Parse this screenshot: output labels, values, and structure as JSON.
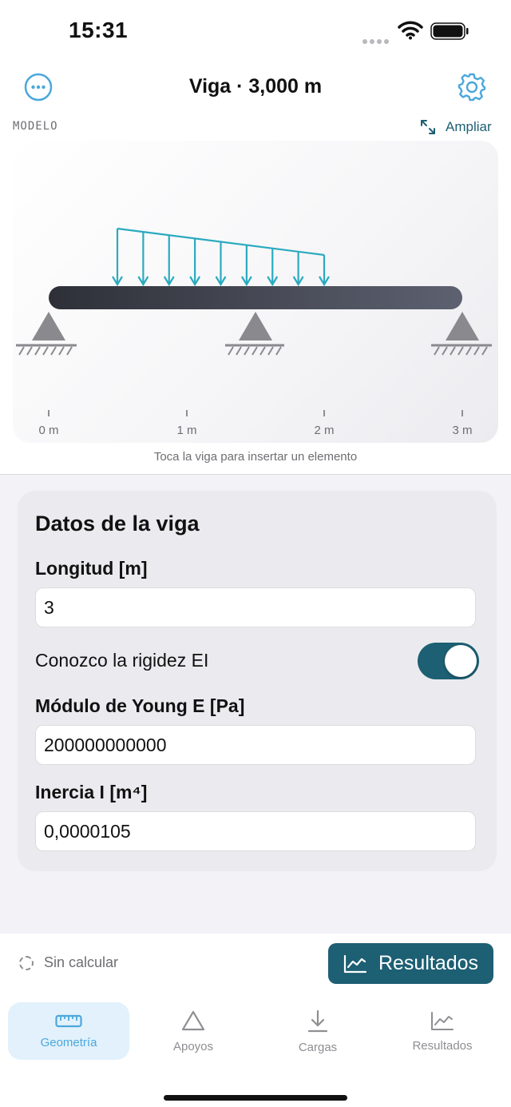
{
  "status_bar": {
    "time": "15:31"
  },
  "nav": {
    "title": "Viga · 3,000 m"
  },
  "model": {
    "section_label": "MODELO",
    "expand_label": "Ampliar",
    "axis_ticks": [
      "0 m",
      "1 m",
      "2 m",
      "3 m"
    ],
    "hint": "Toca la viga para insertar un elemento"
  },
  "beam_data": {
    "title": "Datos de la viga",
    "length_label": "Longitud [m]",
    "length_value": "3",
    "stiffness_toggle_label": "Conozco la rigidez EI",
    "stiffness_toggle_on": true,
    "young_label": "Módulo de Young E [Pa]",
    "young_value": "200000000000",
    "inertia_label": "Inercia I [m⁴]",
    "inertia_value": "0,0000105"
  },
  "bottom": {
    "status": "Sin calcular",
    "results_button": "Resultados"
  },
  "tabs": [
    {
      "label": "Geometría",
      "icon": "ruler-icon",
      "active": true
    },
    {
      "label": "Apoyos",
      "icon": "triangle-icon",
      "active": false
    },
    {
      "label": "Cargas",
      "icon": "arrow-down-icon",
      "active": false
    },
    {
      "label": "Resultados",
      "icon": "chart-icon",
      "active": false
    }
  ],
  "colors": {
    "accent": "#1d5f73",
    "load": "#2aaabf",
    "tab_active": "#4aa8dc",
    "beam": "#3a3d48",
    "support": "#8a8a8e"
  }
}
